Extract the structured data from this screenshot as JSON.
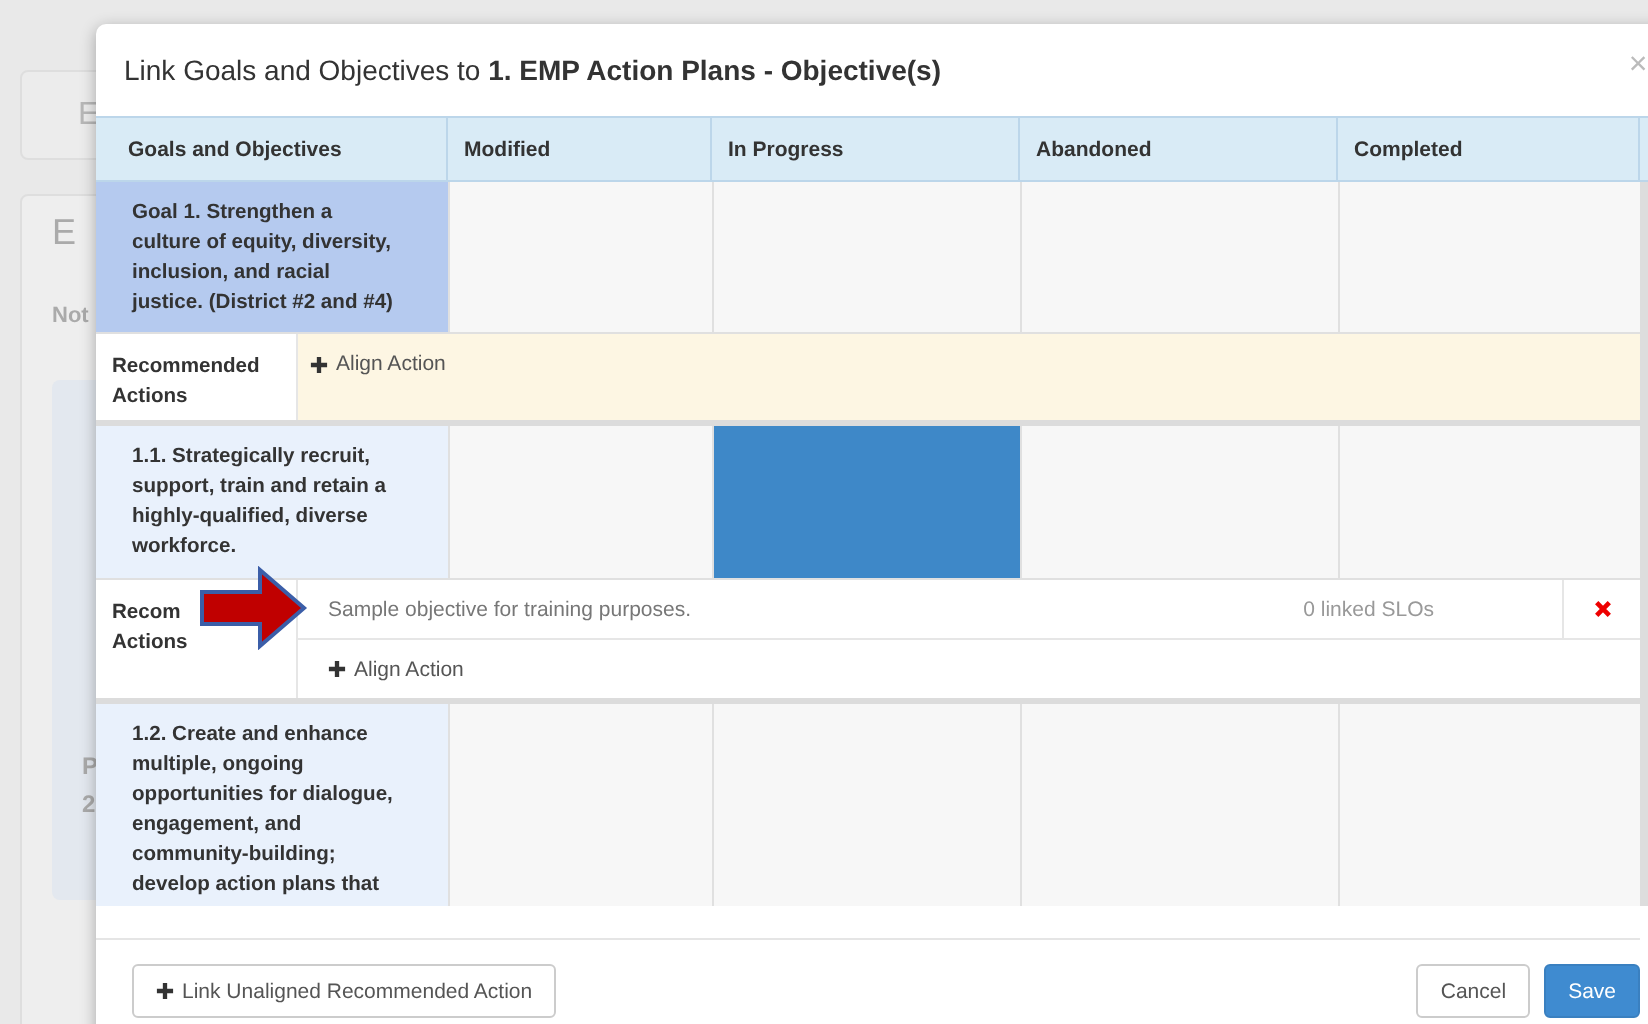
{
  "background_page": {
    "card_1_text": "E",
    "card_2_title": "E",
    "card_2_tab": "Not",
    "card_2_line_1": "P",
    "card_2_line_2": "2"
  },
  "modal": {
    "title_prefix": "Link Goals and Objectives to ",
    "title_bold": "1. EMP Action Plans - Objective(s)",
    "close": "×"
  },
  "table": {
    "columns": [
      "Goals and Objectives",
      "Modified",
      "In Progress",
      "Abandoned",
      "Completed"
    ],
    "rows": [
      {
        "kind": "goal",
        "text": "Goal 1. Strengthen a culture of equity, diversity, inclusion, and racial justice. (District #2 and #4)",
        "cells": [
          {
            "selected": false
          },
          {
            "selected": false
          },
          {
            "selected": false
          },
          {
            "selected": false
          }
        ]
      },
      {
        "kind": "actions",
        "label": "Recommended Actions",
        "actions": [],
        "align": "Align Action"
      },
      {
        "kind": "objective",
        "text": "1.1. Strategically recruit, support, train and retain a highly-qualified, diverse workforce.",
        "cells": [
          {
            "selected": false
          },
          {
            "selected": true
          },
          {
            "selected": false
          },
          {
            "selected": false
          }
        ]
      },
      {
        "kind": "actions",
        "label": "Recom",
        "label_2": "Actions",
        "actions": [
          {
            "text": "Sample objective for training purposes.",
            "slos": "0 linked SLOs"
          }
        ],
        "align": "Align Action"
      },
      {
        "kind": "objective",
        "text": "1.2. Create and enhance multiple, ongoing opportunities for dialogue, engagement, and community-building; develop action plans that",
        "cells": [
          {
            "selected": false
          },
          {
            "selected": false
          },
          {
            "selected": false
          },
          {
            "selected": false
          }
        ]
      }
    ]
  },
  "footer": {
    "link_button": "Link Unaligned Recommended Action",
    "cancel": "Cancel",
    "save": "Save"
  }
}
